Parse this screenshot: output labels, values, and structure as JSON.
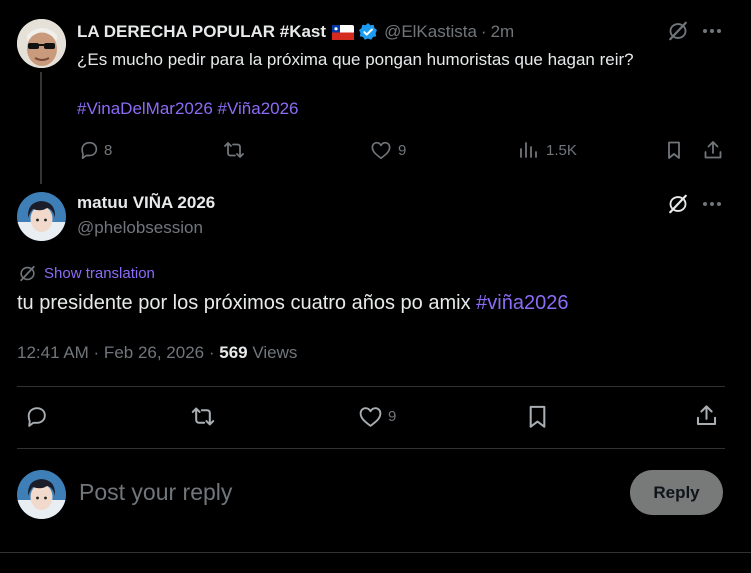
{
  "parent_tweet": {
    "display_name": "LA DERECHA POPULAR #Kast",
    "handle": "@ElKastista",
    "separator": "·",
    "time": "2m",
    "text": "¿Es mucho pedir para la próxima que pongan humoristas que hagan reir?",
    "hashtags": [
      "#VinaDelMar2026",
      "#Viña2026"
    ],
    "replies": "8",
    "likes": "9",
    "views": "1.5K"
  },
  "main_tweet": {
    "display_name": "matuu VIÑA 2026",
    "handle": "@phelobsession",
    "translate_label": "Show translation",
    "text": "tu presidente por los próximos cuatro años po amix",
    "hashtag": "#viña2026",
    "timestamp": "12:41 AM · Feb 26, 2026",
    "dot": "·",
    "view_count": "569",
    "views_label": "Views",
    "likes": "9"
  },
  "reply_box": {
    "placeholder": "Post your reply",
    "button_label": "Reply"
  },
  "colors": {
    "accent": "#8b6cf6",
    "verified": "#1d9bf0",
    "muted": "#71767b",
    "reply_button_bg": "#787a7a"
  }
}
